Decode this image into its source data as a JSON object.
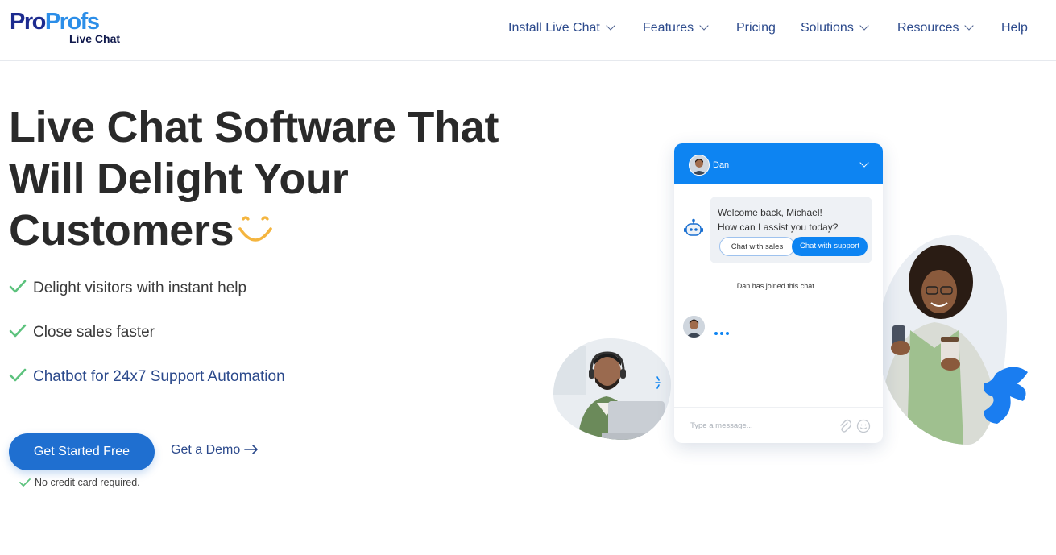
{
  "logo": {
    "part1": "Pro",
    "part2": "Profs",
    "sub": "Live Chat"
  },
  "nav": [
    {
      "label": "Install Live Chat",
      "dropdown": true
    },
    {
      "label": "Features",
      "dropdown": true
    },
    {
      "label": "Pricing",
      "dropdown": false
    },
    {
      "label": "Solutions",
      "dropdown": true
    },
    {
      "label": "Resources",
      "dropdown": true
    },
    {
      "label": "Help",
      "dropdown": false
    }
  ],
  "hero": {
    "title_line1": "Live Chat Software That",
    "title_line2": "Will Delight Your",
    "title_line3": "Customers",
    "bullets": [
      "Delight visitors with instant help",
      "Close sales faster",
      "Chatbot for 24x7 Support Automation"
    ],
    "cta_label": "Get Started Free",
    "demo_label": "Get a Demo",
    "note": "No credit card required."
  },
  "chat_widget": {
    "agent_name": "Dan",
    "greeting_line1": "Welcome back, Michael!",
    "greeting_line2": "How can I assist you today?",
    "btn_sales": "Chat with sales",
    "btn_support": "Chat with support",
    "joined_text": "Dan has joined this chat...",
    "input_placeholder": "Type a message..."
  },
  "colors": {
    "brand_dark": "#1c2b8f",
    "brand_light": "#2c8ee8",
    "cta": "#1f6fd0",
    "check": "#5cc27d",
    "nav_text": "#2c4a8c",
    "chat_blue": "#0d84f2",
    "smile": "#f4b53f"
  }
}
